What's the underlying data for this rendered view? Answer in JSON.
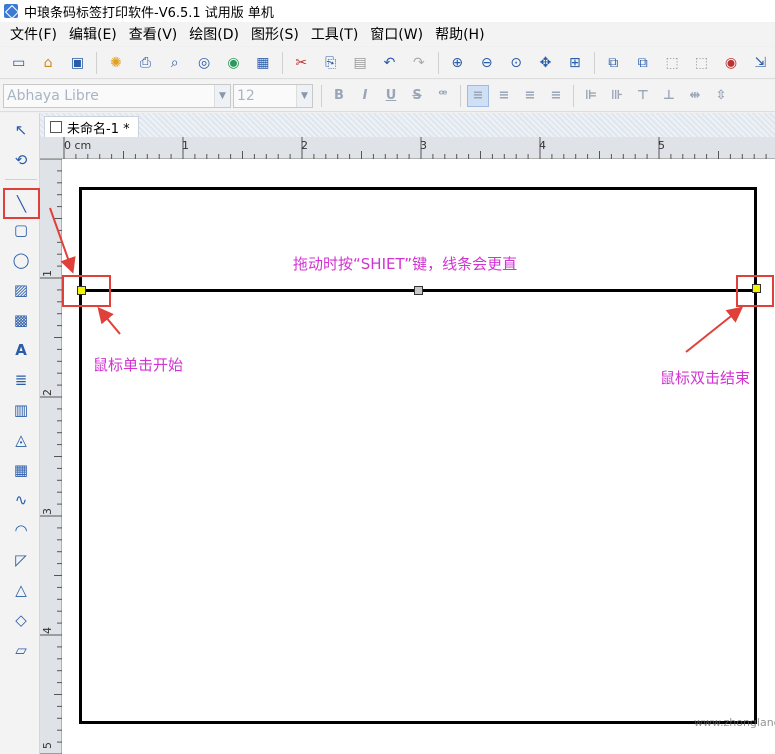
{
  "window": {
    "title": "中琅条码标签打印软件-V6.5.1 试用版 单机",
    "brand_color": "#3a7bd5"
  },
  "menu": [
    "文件(F)",
    "编辑(E)",
    "查看(V)",
    "绘图(D)",
    "图形(S)",
    "工具(T)",
    "窗口(W)",
    "帮助(H)"
  ],
  "toolbar": {
    "buttons": [
      "window-icon",
      "open-icon",
      "save-icon",
      "settings-icon",
      "print-icon",
      "print-preview-icon",
      "database-icon",
      "data-source-icon",
      "grid-icon",
      "cut-icon",
      "copy-icon",
      "paste-icon",
      "undo-icon",
      "redo-icon",
      "zoom-in-icon",
      "zoom-out-icon",
      "zoom-fit-icon",
      "fit-page-icon",
      "actual-size-icon",
      "bring-front-icon",
      "send-back-icon",
      "group-icon",
      "ungroup-icon",
      "preview-eye-icon",
      "export-icon"
    ]
  },
  "font_toolbar": {
    "font_name": "Abhaya Libre",
    "font_size": "12",
    "bold": "B",
    "italic": "I",
    "underline": "U",
    "strike": "S"
  },
  "palette": {
    "tools": [
      "select-icon",
      "rotate-icon",
      "line-tool-icon",
      "rounded-rect-icon",
      "ellipse-icon",
      "image-icon",
      "picture-icon",
      "text-icon",
      "paragraph-text-icon",
      "barcode-icon",
      "qrcode-icon",
      "data-matrix-icon",
      "curve-icon",
      "arc-icon",
      "polygon-icon",
      "triangle-icon",
      "diamond-icon",
      "parallelogram-icon"
    ],
    "highlight_color": "#e0403a"
  },
  "document": {
    "tab_title": "未命名-1 *"
  },
  "ruler": {
    "h_labels": [
      "0 cm",
      "1",
      "2",
      "3",
      "4",
      "5"
    ],
    "v_labels": [
      "1",
      "2",
      "3",
      "4",
      "5"
    ]
  },
  "annotations": {
    "hint": "拖动时按“SHIET”键，线条会更直",
    "start": "鼠标单击开始",
    "end": "鼠标双击结束",
    "color": "#d233d2"
  },
  "watermark": "www.zhonglang.com"
}
